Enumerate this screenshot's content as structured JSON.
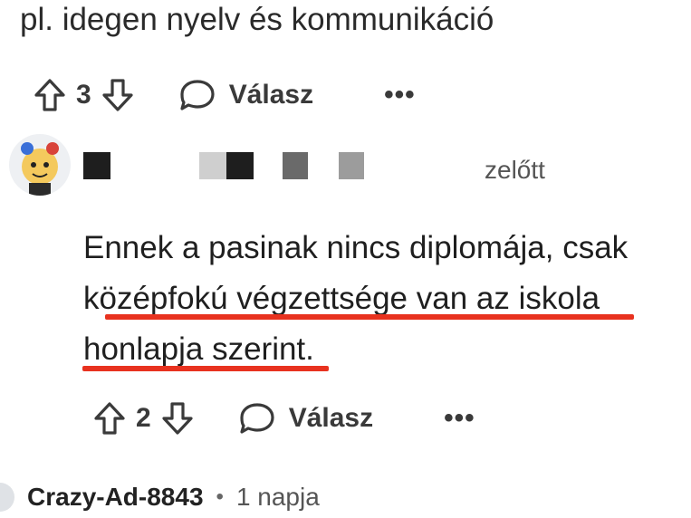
{
  "prev_comment": {
    "text_tail": "pl. idegen nyelv és kommunikáció"
  },
  "prev_actions": {
    "upvotes": "3",
    "reply_label": "Válasz",
    "more_label": "•••"
  },
  "comment": {
    "time_fragment": "zelőtt",
    "line1": "Ennek a pasinak nincs diplomája, csak",
    "line2": "középfokú végzettsége van az iskola",
    "line3": "honlapja szerint.",
    "highlight_color": "#e8321f"
  },
  "actions": {
    "upvotes": "2",
    "reply_label": "Válasz",
    "more_label": "•••"
  },
  "next_comment": {
    "username": "Crazy-Ad-8843",
    "separator": "•",
    "time": "1 napja"
  },
  "icons": [
    "upvote-arrow-icon",
    "downvote-arrow-icon",
    "speech-bubble-icon",
    "more-options-icon"
  ]
}
